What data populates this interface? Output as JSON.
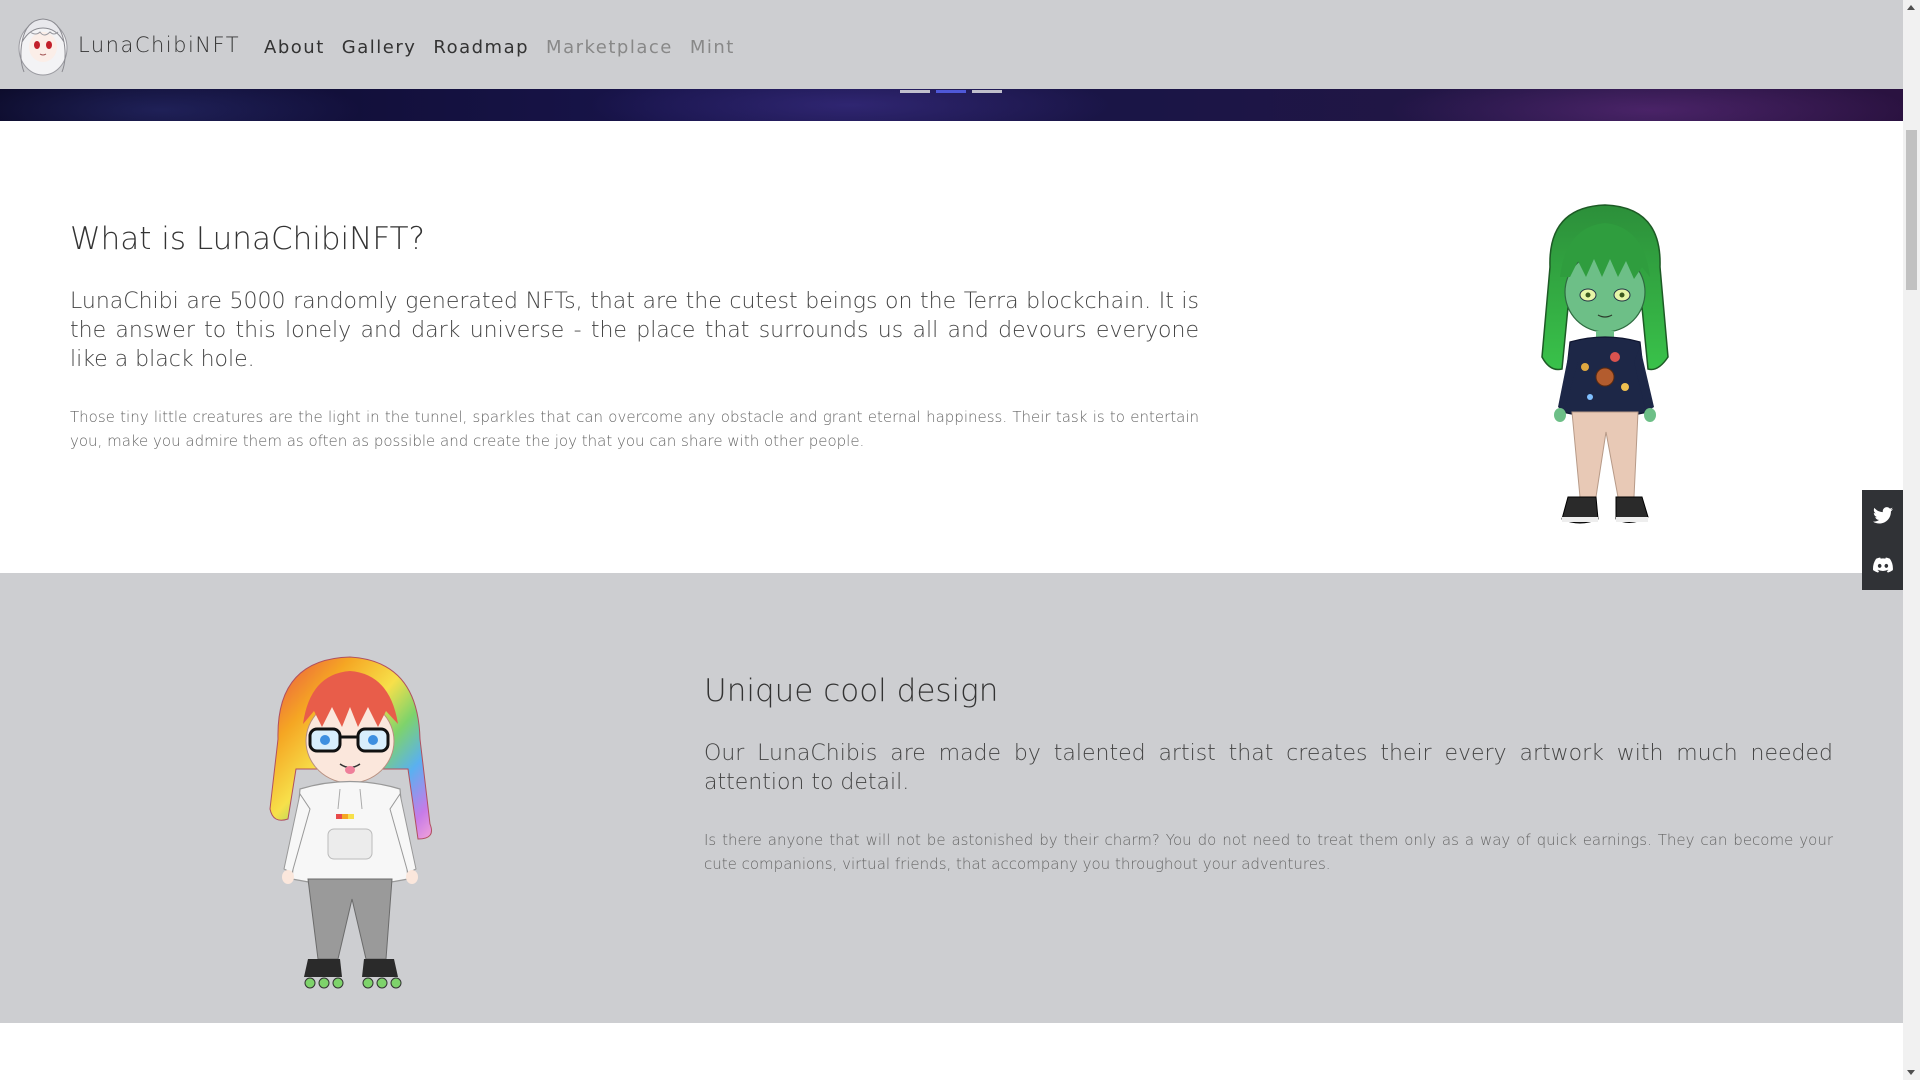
{
  "navbar": {
    "brand": "LunaChibiNFT",
    "links": [
      {
        "label": "About",
        "muted": false
      },
      {
        "label": "Gallery",
        "muted": false
      },
      {
        "label": "Roadmap",
        "muted": false
      },
      {
        "label": "Marketplace",
        "muted": true
      },
      {
        "label": "Mint",
        "muted": true
      }
    ]
  },
  "carousel": {
    "slide_count": 3,
    "active_index": 1
  },
  "about": {
    "title": "What is LunaChibiNFT?",
    "lead": "LunaChibi are 5000 randomly generated NFTs, that are the cutest beings on the Terra blockchain. It is the answer to this lonely and dark universe - the place that surrounds us all and devours everyone like a black hole.",
    "body": "Those tiny little creatures are the light in the tunnel, sparkles that can overcome any obstacle and grant eternal happiness. Their task is to entertain you, make you admire them as often as possible and create the joy that you can share with other people."
  },
  "design": {
    "title": "Unique cool design",
    "lead": "Our LunaChibis are made by talented artist that creates their every artwork with much needed attention to detail.",
    "body": "Is there anyone that will not be astonished by their charm? You do not need to treat them only as a way of quick earnings. They can become your cute companions, virtual friends, that accompany you throughout your adventures."
  },
  "social": {
    "items": [
      {
        "icon": "twitter-icon"
      },
      {
        "icon": "discord-icon"
      }
    ]
  },
  "colors": {
    "navbar_bg": "#cdced1",
    "section_alt_bg": "#cdced1",
    "indicator_active": "#4f58d8",
    "social_bar_bg": "#303236"
  }
}
